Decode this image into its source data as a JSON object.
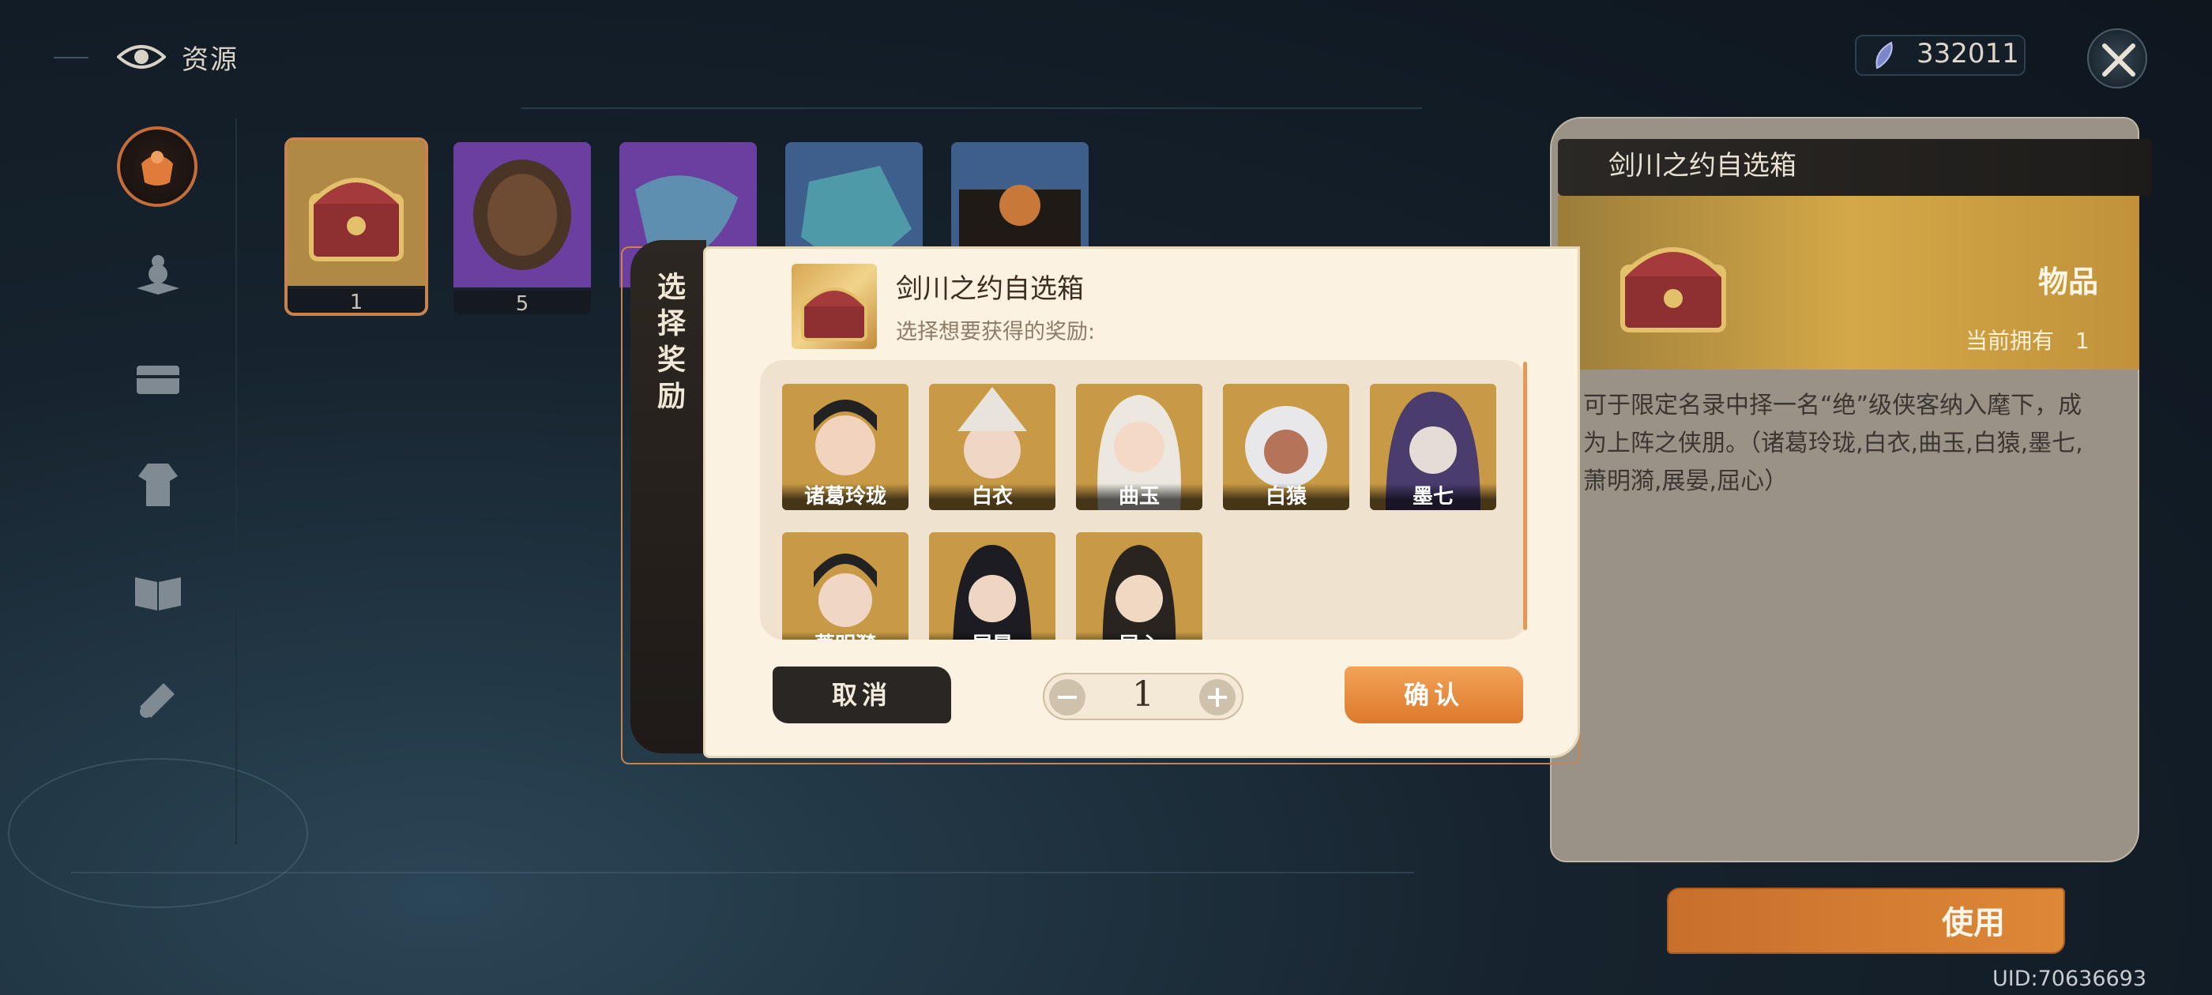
{
  "header": {
    "title": "资源",
    "currency": {
      "value": "332011",
      "icon": "feather-gem-icon"
    }
  },
  "sidebar": {
    "items": [
      {
        "icon": "gift-bag-icon",
        "active": true
      },
      {
        "icon": "gourd-book-icon",
        "active": false
      },
      {
        "icon": "chest-icon",
        "active": false
      },
      {
        "icon": "robe-icon",
        "active": false
      },
      {
        "icon": "open-book-icon",
        "active": false
      },
      {
        "icon": "scroll-icon",
        "active": false
      }
    ]
  },
  "inventory": {
    "slots": [
      {
        "name": "chest",
        "count": "1",
        "color": "#b08a45"
      },
      {
        "name": "pine-cone",
        "count": "5",
        "color": "#6b3fa0"
      },
      {
        "name": "blue-stone",
        "count": "",
        "color": "#6b3fa0"
      },
      {
        "name": "blue-ore",
        "count": "",
        "color": "#3e5f8c"
      },
      {
        "name": "box-orb",
        "count": "",
        "color": "#3e5f8c"
      }
    ]
  },
  "dialog": {
    "tab_label": "选择奖励",
    "item_name": "剑川之约自选箱",
    "prompt": "选择想要获得的奖励:",
    "heroes": [
      {
        "name": "诸葛玲珑"
      },
      {
        "name": "白衣"
      },
      {
        "name": "曲玉"
      },
      {
        "name": "白猿"
      },
      {
        "name": "墨七"
      },
      {
        "name": "萧明漪"
      },
      {
        "name": "展晏"
      },
      {
        "name": "屈心"
      }
    ],
    "cancel_label": "取消",
    "quantity": "1",
    "confirm_label": "确认"
  },
  "detail": {
    "title": "剑川之约自选箱",
    "type": "物品",
    "owned_label": "当前拥有",
    "owned_value": "1",
    "description": "可于限定名录中择一名“绝”级侠客纳入麾下，成为上阵之侠朋。（诸葛玲珑,白衣,曲玉,白猿,墨七,萧明漪,展晏,屈心）"
  },
  "use_label": "使用",
  "uid": "UID:70636693",
  "colors": {
    "accent": "#e08530",
    "panel_bg": "#fbf2e2",
    "dark": "#2a2623"
  }
}
